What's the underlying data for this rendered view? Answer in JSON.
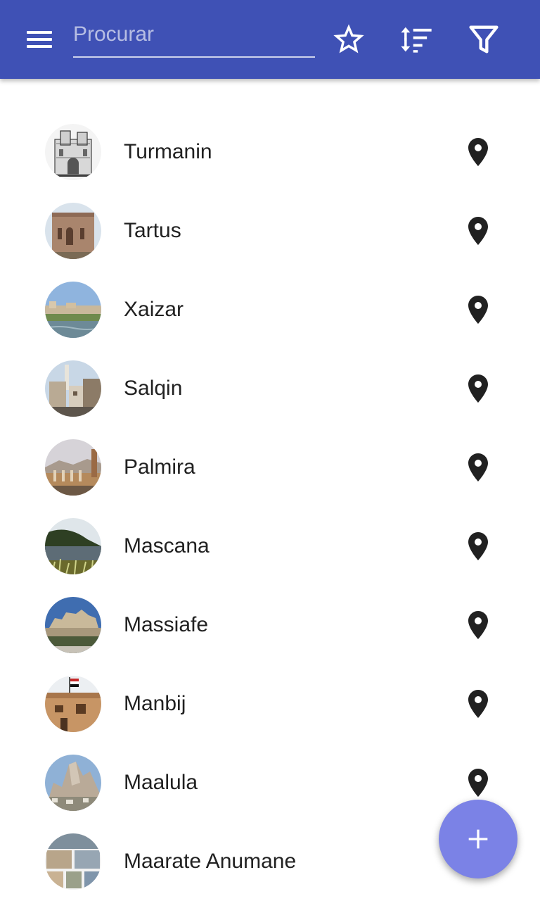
{
  "search": {
    "placeholder": "Procurar",
    "value": ""
  },
  "toolbar": {
    "icons": [
      "menu-icon",
      "star-outline-icon",
      "sort-icon",
      "filter-icon"
    ],
    "background": "#3f51b5"
  },
  "places": [
    {
      "name": "Turmanin",
      "thumb": "sketch-ruins"
    },
    {
      "name": "Tartus",
      "thumb": "stone-church"
    },
    {
      "name": "Xaizar",
      "thumb": "river-town"
    },
    {
      "name": "Salqin",
      "thumb": "town-minaret"
    },
    {
      "name": "Palmira",
      "thumb": "ruins-columns"
    },
    {
      "name": "Mascana",
      "thumb": "lake-hills"
    },
    {
      "name": "Massiafe",
      "thumb": "castle-hill"
    },
    {
      "name": "Manbij",
      "thumb": "building-flag"
    },
    {
      "name": "Maalula",
      "thumb": "mountain-village"
    },
    {
      "name": "Maarate Anumane",
      "thumb": "collage"
    }
  ],
  "fab": {
    "icon": "plus-icon",
    "color": "#7b82e6"
  }
}
